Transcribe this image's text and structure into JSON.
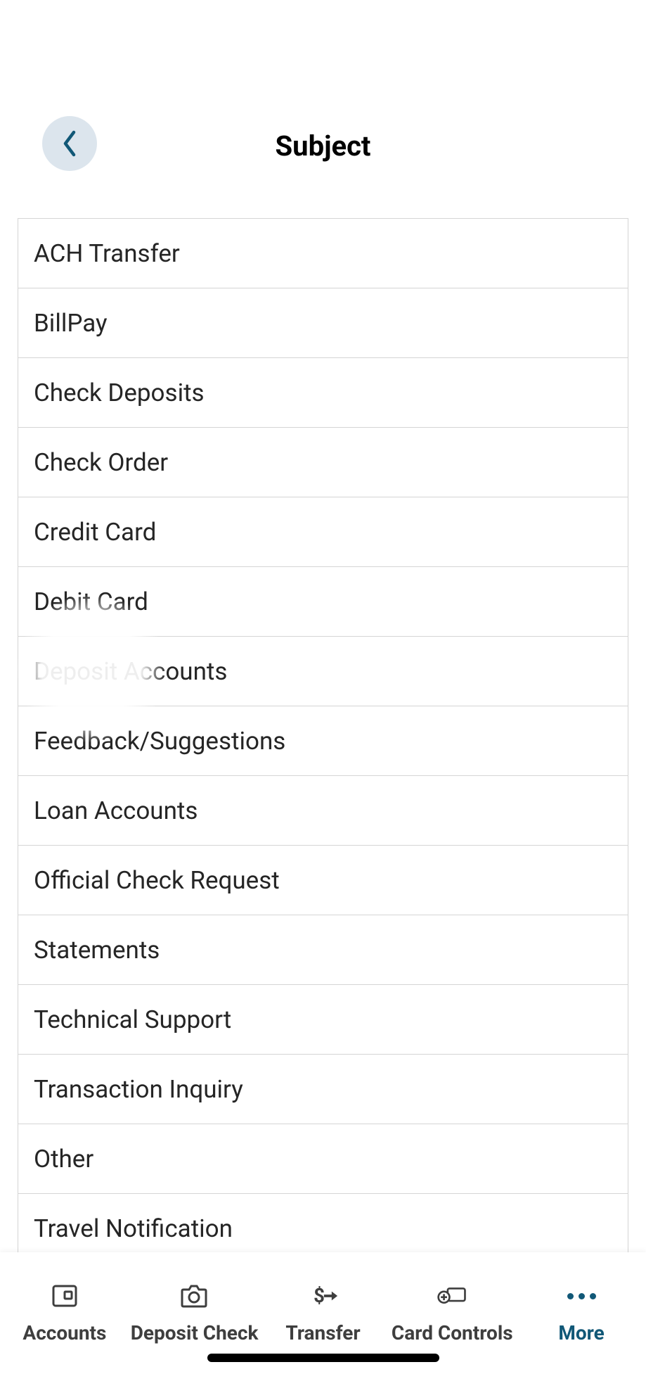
{
  "header": {
    "title": "Subject"
  },
  "subjects": [
    "ACH Transfer",
    "BillPay",
    "Check Deposits",
    "Check Order",
    "Credit Card",
    "Debit Card",
    "Deposit Accounts",
    "Feedback/Suggestions",
    "Loan Accounts",
    "Official Check Request",
    "Statements",
    "Technical Support",
    "Transaction Inquiry",
    "Other",
    "Travel Notification"
  ],
  "tabs": [
    {
      "label": "Accounts",
      "icon": "accounts-icon",
      "active": false
    },
    {
      "label": "Deposit Check",
      "icon": "camera-icon",
      "active": false
    },
    {
      "label": "Transfer",
      "icon": "transfer-icon",
      "active": false
    },
    {
      "label": "Card Controls",
      "icon": "card-controls-icon",
      "active": false
    },
    {
      "label": "More",
      "icon": "more-icon",
      "active": true
    }
  ]
}
